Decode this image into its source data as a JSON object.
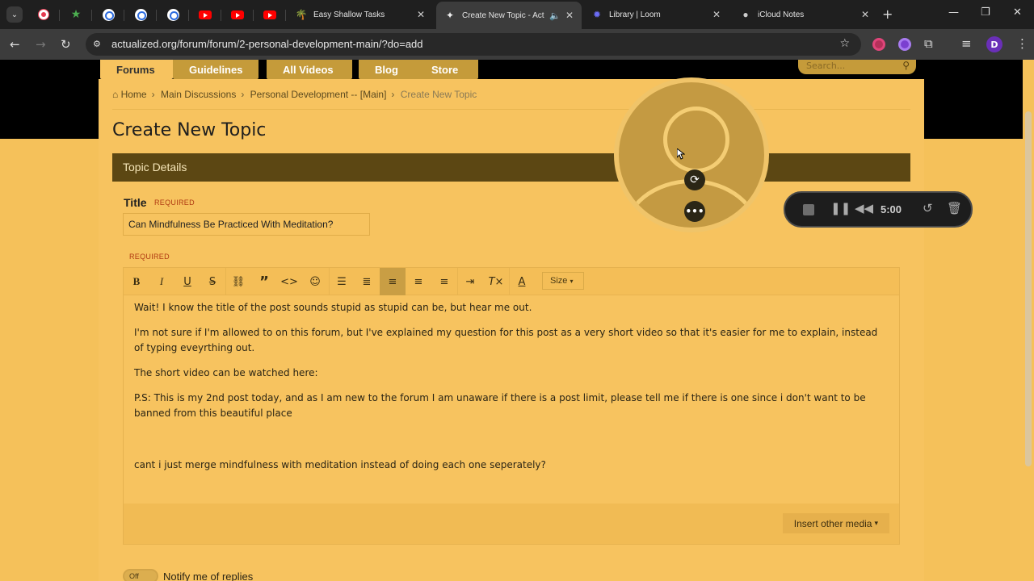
{
  "browser": {
    "tabs": [
      {
        "title": "Easy Shallow Tasks"
      },
      {
        "title": "Create New Topic - Actu"
      },
      {
        "title": "Library | Loom"
      },
      {
        "title": "iCloud Notes"
      }
    ],
    "url": "actualized.org/forum/forum/2-personal-development-main/?do=add",
    "profile_initial": "D"
  },
  "site": {
    "nav": [
      "Forums",
      "Guidelines",
      "All Videos",
      "Blog",
      "Store"
    ],
    "search_placeholder": "Search...",
    "breadcrumb": [
      "Home",
      "Main Discussions",
      "Personal Development -- [Main]",
      "Create New Topic"
    ]
  },
  "form": {
    "page_title": "Create New Topic",
    "section": "Topic Details",
    "title_label": "Title",
    "required": "REQUIRED",
    "title_value": "Can Mindfulness Be Practiced With Meditation?",
    "size_label": "Size",
    "body": [
      "Wait! I know the title of the post sounds stupid as stupid can be, but hear me out.",
      "I'm not sure if I'm allowed to on this forum, but I've explained my question for this post as a very short video so that it's easier for me to explain, instead of typing eveyrthing out.",
      "The short video can be watched here:",
      "P.S: This is my 2nd post today, and as I am new to the forum I am unaware if there is a post limit, please tell me if there is one since i don't want to be banned from this beautiful place",
      "cant i just merge mindfulness with meditation instead of doing each one seperately?"
    ],
    "insert_media": "Insert other media",
    "notify_toggle": "Off",
    "notify_label": "Notify me of replies"
  },
  "loom": {
    "timer": "5:00"
  },
  "colors": {
    "page_bg": "#f5c15a",
    "section_bar": "#5c4713",
    "nav_tab": "#c59b3a"
  }
}
